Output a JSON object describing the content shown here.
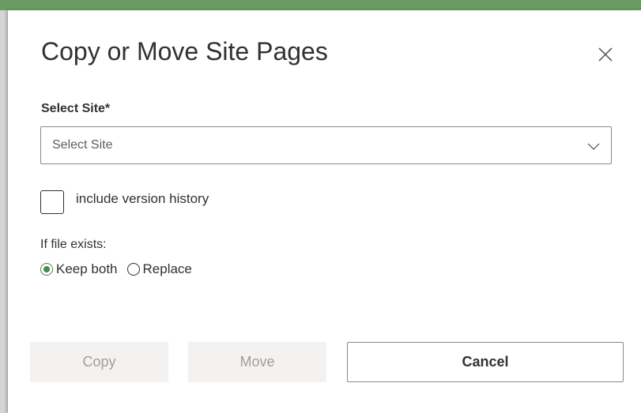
{
  "dialog": {
    "title": "Copy or Move Site Pages",
    "close_icon": "close-icon"
  },
  "site_select": {
    "label": "Select Site*",
    "value": "Select Site",
    "chevron_icon": "chevron-down-icon"
  },
  "version_history": {
    "label": "include version history",
    "checked": false
  },
  "file_exists": {
    "label": "If file exists:",
    "options": [
      {
        "label": "Keep both",
        "selected": true
      },
      {
        "label": "Replace",
        "selected": false
      }
    ]
  },
  "buttons": {
    "copy": "Copy",
    "move": "Move",
    "cancel": "Cancel"
  },
  "colors": {
    "accent": "#4a8a4a",
    "top_bar": "#6a9b62",
    "disabled_bg": "#f3f2f1",
    "disabled_text": "#a19f9d"
  }
}
